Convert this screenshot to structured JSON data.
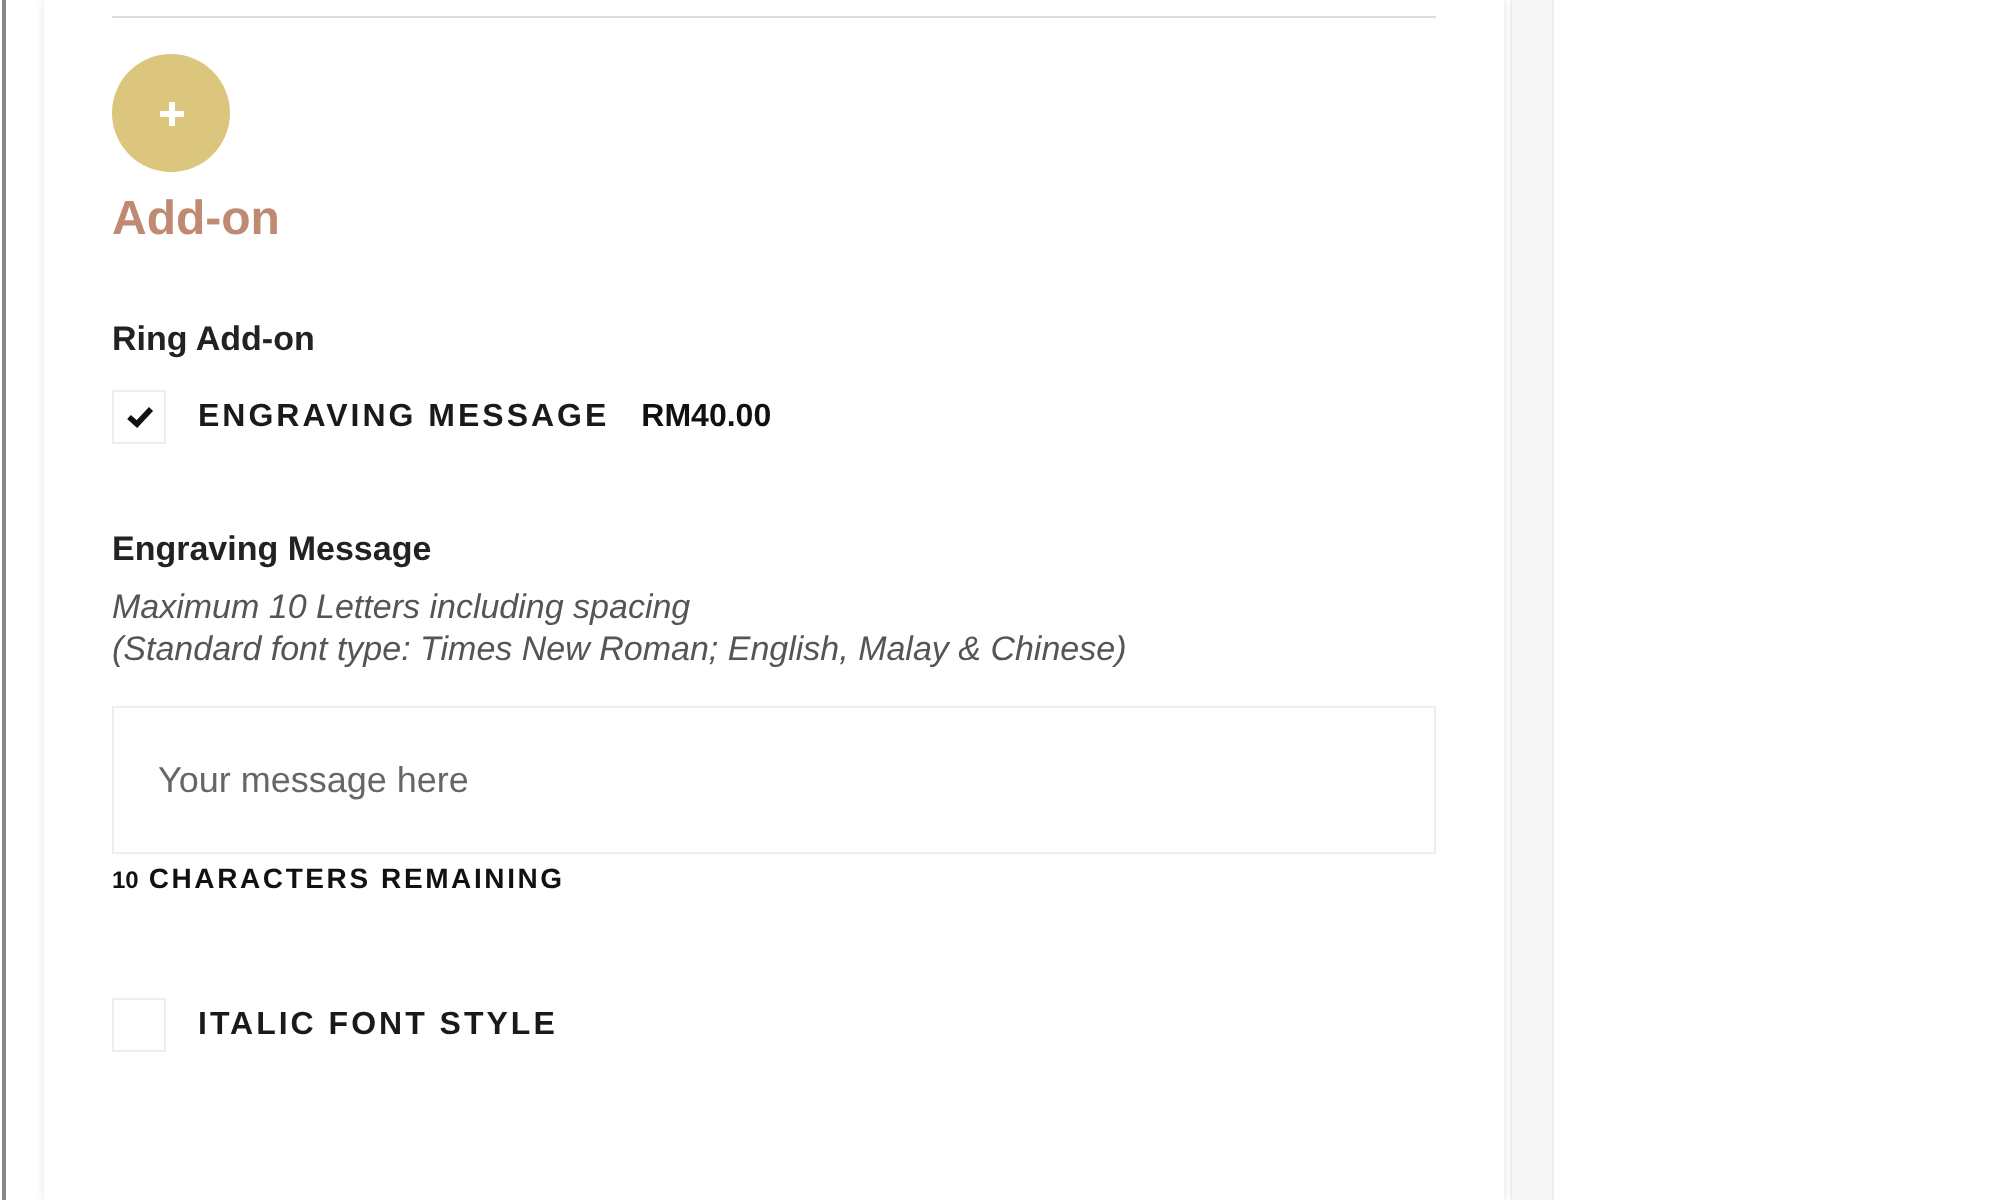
{
  "section": {
    "title": "Add-on"
  },
  "group": {
    "label": "Ring Add-on"
  },
  "options": [
    {
      "label": "ENGRAVING MESSAGE",
      "price": "RM40.00",
      "checked": true
    }
  ],
  "message": {
    "label": "Engraving Message",
    "hints": [
      "Maximum 10 Letters including spacing",
      "(Standard font type: Times New Roman; English, Malay & Chinese)"
    ],
    "placeholder": "Your message here",
    "counter_number": "10",
    "counter_text": "CHARACTERS REMAINING"
  },
  "style_options": [
    {
      "label": "ITALIC FONT STYLE",
      "checked": false
    }
  ]
}
